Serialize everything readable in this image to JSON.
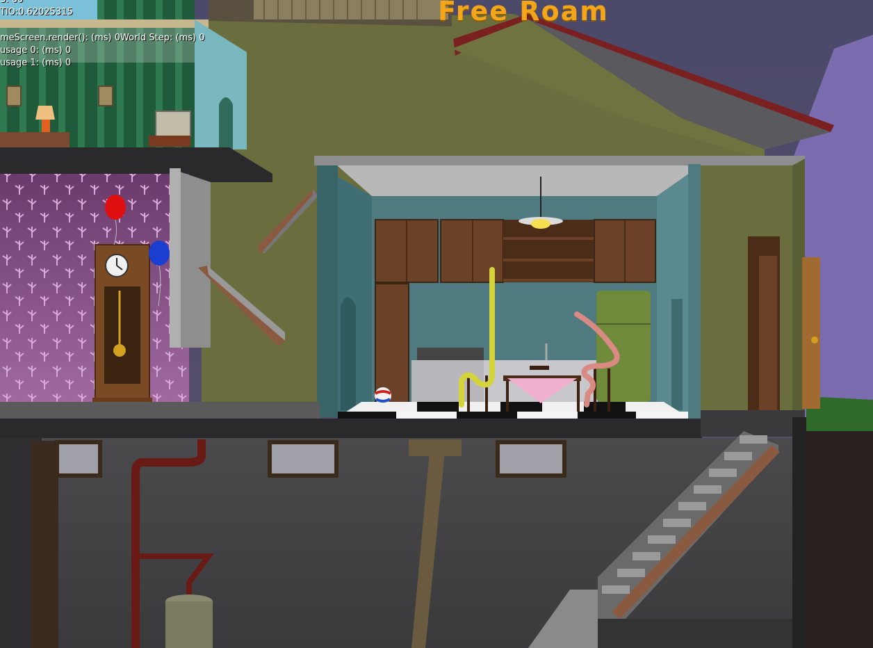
{
  "hud": {
    "mode_title": "Free Roam"
  },
  "debug": {
    "line_fps": "S: 60",
    "line_ratio": "TIO:0.62025315",
    "line_render": "meScreen.render(): (ms) 0World Step: (ms) 0",
    "line_usage0": "usage 0: (ms) 0",
    "line_usage1": "usage 1: (ms) 0"
  },
  "scene": {
    "objects": [
      "grandfather-clock",
      "red-balloon",
      "blue-balloon",
      "kitchen",
      "refrigerator",
      "stove",
      "dining-table",
      "pink-tablecloth",
      "ceiling-lamp",
      "beach-ball",
      "yellow-worm",
      "pink-worm",
      "basement-stairs",
      "upstairs-stairs",
      "front-door",
      "water-heater",
      "pipes"
    ],
    "colors": {
      "wallpaper": "#8f5a8f",
      "kitchen_wall": "#4e7a80",
      "cabinets": "#6b4128",
      "fridge": "#6e8a3a",
      "yellow_worm": "#d4d43a",
      "pink_worm": "#d98a82",
      "balloon_red": "#e01010",
      "balloon_blue": "#1a3fd0",
      "title": "#f3a61a"
    }
  }
}
